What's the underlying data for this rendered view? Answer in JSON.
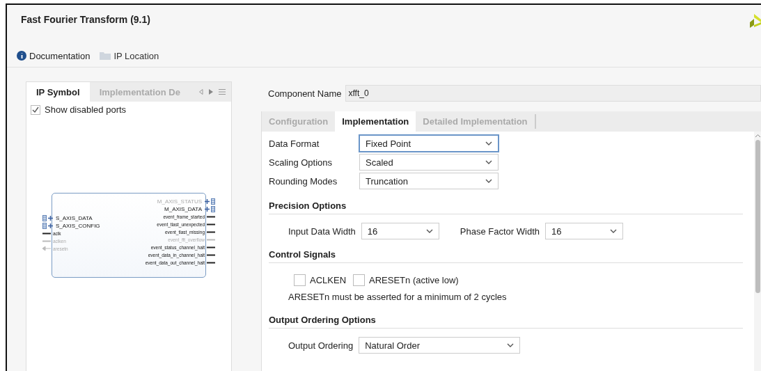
{
  "window": {
    "title": "Fast Fourier Transform (9.1)"
  },
  "toolbar": [
    {
      "label": "Documentation",
      "kind": "info"
    },
    {
      "label": "IP Location",
      "kind": "folder"
    }
  ],
  "left_panel": {
    "tabs": [
      {
        "label": "IP Symbol",
        "selected": true
      },
      {
        "label": "Implementation De",
        "selected": false
      }
    ],
    "show_disabled_ports": {
      "label": "Show disabled ports",
      "checked": true
    },
    "symbol": {
      "left_ports": [
        {
          "name": "S_AXIS_DATA",
          "kind": "bus",
          "disabled": false
        },
        {
          "name": "S_AXIS_CONFIG",
          "kind": "bus",
          "disabled": false
        },
        {
          "name": "aclk",
          "kind": "wire",
          "disabled": false
        },
        {
          "name": "aclken",
          "kind": "wire",
          "disabled": true
        },
        {
          "name": "aresetn",
          "kind": "reset",
          "disabled": true
        }
      ],
      "right_ports": [
        {
          "name": "M_AXIS_STATUS",
          "kind": "bus",
          "disabled": true
        },
        {
          "name": "M_AXIS_DATA",
          "kind": "bus",
          "disabled": false
        },
        {
          "name": "event_frame_started",
          "kind": "wire",
          "disabled": false
        },
        {
          "name": "event_tlast_unexpected",
          "kind": "wire",
          "disabled": false
        },
        {
          "name": "event_tlast_missing",
          "kind": "wire",
          "disabled": false
        },
        {
          "name": "event_fft_overflow",
          "kind": "wire",
          "disabled": true
        },
        {
          "name": "event_status_channel_halt",
          "kind": "wire",
          "disabled": false
        },
        {
          "name": "event_data_in_channel_halt",
          "kind": "wire",
          "disabled": false
        },
        {
          "name": "event_data_out_channel_halt",
          "kind": "wire",
          "disabled": false
        }
      ]
    }
  },
  "component_name": {
    "label": "Component Name",
    "value": "xfft_0"
  },
  "tabs": [
    {
      "label": "Configuration",
      "selected": false
    },
    {
      "label": "Implementation",
      "selected": true
    },
    {
      "label": "Detailed Implementation",
      "selected": false
    }
  ],
  "fields": [
    {
      "label": "Data Format",
      "value": "Fixed Point",
      "focused": true
    },
    {
      "label": "Scaling Options",
      "value": "Scaled",
      "focused": false
    },
    {
      "label": "Rounding Modes",
      "value": "Truncation",
      "focused": false
    }
  ],
  "sections": [
    {
      "title": "Precision Options",
      "kind": "fields",
      "fields": [
        {
          "label": "Input Data Width",
          "value": "16"
        },
        {
          "label": "Phase Factor Width",
          "value": "16"
        }
      ]
    },
    {
      "title": "Control Signals",
      "kind": "checks",
      "checkboxes": [
        {
          "label": "ACLKEN",
          "checked": false
        },
        {
          "label": "ARESETn (active low)",
          "checked": false
        }
      ],
      "note": "ARESETn must be asserted for a minimum of 2 cycles"
    },
    {
      "title": "Output Ordering Options",
      "kind": "fields",
      "fields": [
        {
          "label": "Output Ordering",
          "value": "Natural Order"
        }
      ]
    }
  ]
}
